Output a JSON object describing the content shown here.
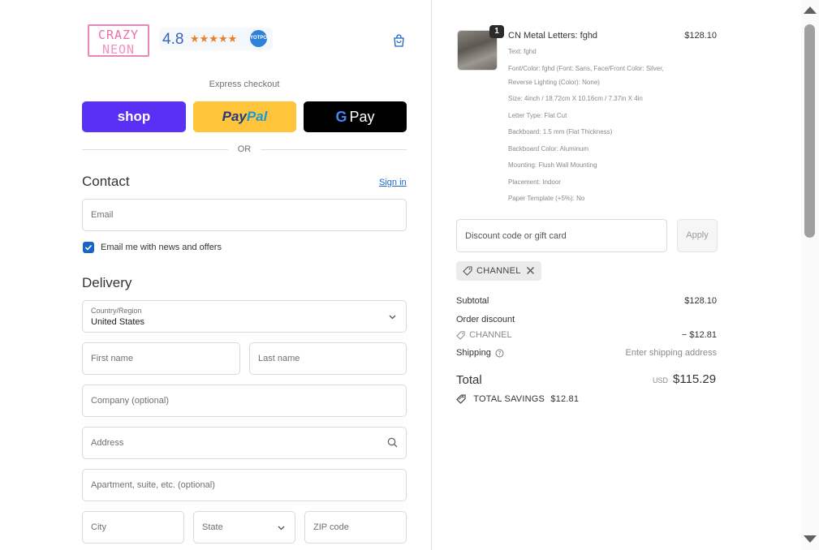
{
  "brand": {
    "logo_line1": "CRAZY",
    "logo_line2": "NEON",
    "rating": "4.8",
    "stars": "★★★★★",
    "review_badge": "YOTPO."
  },
  "express": {
    "label": "Express checkout",
    "shop": "shop",
    "paypal_1": "Pay",
    "paypal_2": "Pal",
    "gpay_g": "G",
    "gpay_text": "Pay",
    "or": "OR"
  },
  "contact": {
    "title": "Contact",
    "signin": "Sign in",
    "email_placeholder": "Email",
    "newsletter_label": "Email me with news and offers",
    "newsletter_checked": true
  },
  "delivery": {
    "title": "Delivery",
    "country_label": "Country/Region",
    "country_value": "United States",
    "first_name": "First name",
    "last_name": "Last name",
    "company": "Company (optional)",
    "address": "Address",
    "apartment": "Apartment, suite, etc. (optional)",
    "city": "City",
    "state": "State",
    "zip": "ZIP code"
  },
  "order": {
    "item": {
      "quantity": "1",
      "name": "CN Metal Letters: fghd",
      "price": "$128.10",
      "attributes": [
        "Text: fghd",
        "Font/Color: fghd (Font: Sans, Face/Front Color: Silver, Reverse Lighting (Color): None)",
        "Size: 4inch / 18.72cm X 10.16cm / 7.37in X 4in",
        "Letter Type: Flat Cut",
        "Backboard: 1.5 mm (Flat Thickness)",
        "Backboard Color: Aluminum",
        "Mounting: Flush Wall Mounting",
        "Placement: Indoor",
        "Paper Template (+5%): No"
      ]
    },
    "discount_placeholder": "Discount code or gift card",
    "apply": "Apply",
    "applied_code": "CHANNEL",
    "subtotal_label": "Subtotal",
    "subtotal_value": "$128.10",
    "order_discount_label": "Order discount",
    "discount_code": "CHANNEL",
    "discount_value": "− $12.81",
    "shipping_label": "Shipping",
    "shipping_value": "Enter shipping address",
    "total_label": "Total",
    "currency": "USD",
    "total_value": "$115.29",
    "savings_label": "TOTAL SAVINGS",
    "savings_value": "$12.81"
  },
  "colors": {
    "accent": "#1a64c6",
    "shop_pay": "#5a31f4",
    "paypal": "#ffc439",
    "gpay": "#000000",
    "logo_pink": "#ec6fab"
  }
}
